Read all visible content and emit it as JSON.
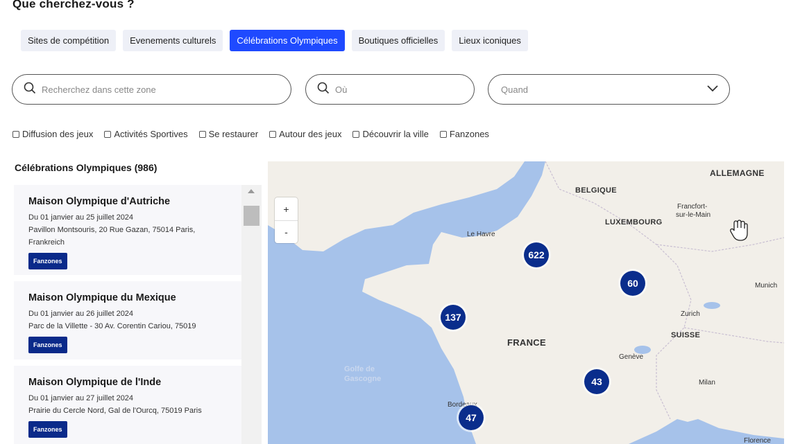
{
  "heading": "Que cherchez-vous ?",
  "tabs": [
    {
      "label": "Sites de compétition",
      "active": false
    },
    {
      "label": "Evenements culturels",
      "active": false
    },
    {
      "label": "Célébrations Olympiques",
      "active": true
    },
    {
      "label": "Boutiques officielles",
      "active": false
    },
    {
      "label": "Lieux iconiques",
      "active": false
    }
  ],
  "search": {
    "zone_placeholder": "Recherchez dans cette zone",
    "where_placeholder": "Où",
    "when_placeholder": "Quand"
  },
  "filters": [
    "Diffusion des jeux",
    "Activités Sportives",
    "Se restaurer",
    "Autour des jeux",
    "Découvrir la ville",
    "Fanzones"
  ],
  "results": {
    "title": "Célébrations Olympiques (986)",
    "items": [
      {
        "name": "Maison Olympique d'Autriche",
        "dates": "Du 01 janvier au 25 juillet 2024",
        "address1": "Pavillon Montsouris, 20 Rue Gazan, 75014 Paris,",
        "address2": "Frankreich",
        "tag": "Fanzones"
      },
      {
        "name": "Maison Olympique du Mexique",
        "dates": "Du 01 janvier au 26 juillet 2024",
        "address1": "Parc de la Villette - 30 Av. Corentin Cariou, 75019",
        "address2": "",
        "tag": "Fanzones"
      },
      {
        "name": "Maison Olympique de l'Inde",
        "dates": "Du 01 janvier au 27 juillet 2024",
        "address1": "Prairie du Cercle Nord, Gal de l'Ourcq, 75019 Paris",
        "address2": "",
        "tag": "Fanzones"
      }
    ]
  },
  "map": {
    "zoom_in": "+",
    "zoom_out": "-",
    "clusters": [
      "622",
      "60",
      "137",
      "43",
      "47"
    ],
    "labels": {
      "allemagne": "ALLEMAGNE",
      "belgique": "BELGIQUE",
      "luxembourg": "LUXEMBOURG",
      "frankfurt1": "Francfort-",
      "frankfurt2": "sur-le-Main",
      "le_havre": "Le Havre",
      "munich": "Munich",
      "zurich": "Zurich",
      "suisse": "SUISSE",
      "france": "FRANCE",
      "geneve": "Genève",
      "milan": "Milan",
      "bordeaux": "Bordeaux",
      "florence": "Florence",
      "golfe1": "Golfe de",
      "golfe2": "Gascogne"
    }
  },
  "colors": {
    "accent": "#1f4aff",
    "cluster": "#0a2d8c",
    "badge": "#0a2a8a",
    "sea": "#a6c2ea",
    "land": "#f2efe9"
  }
}
